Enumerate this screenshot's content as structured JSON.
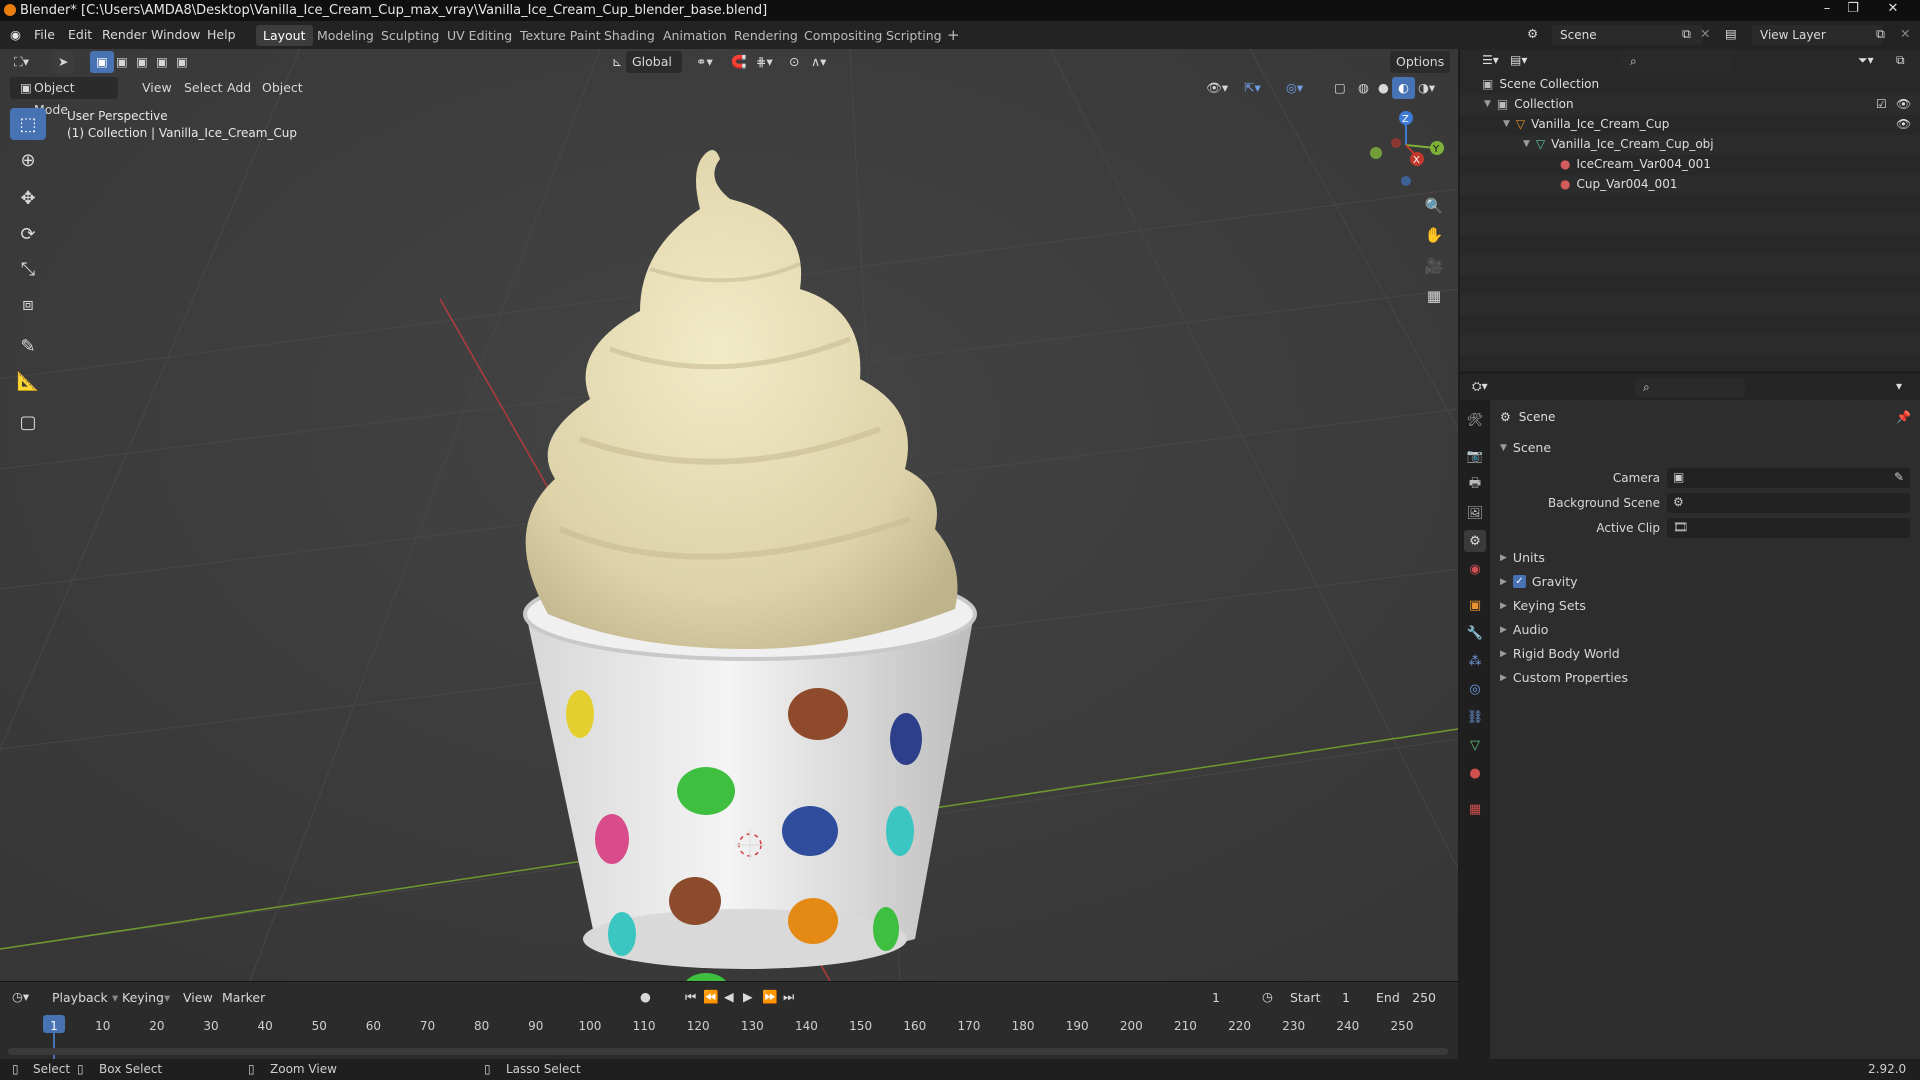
{
  "window": {
    "title": "Blender* [C:\\Users\\AMDA8\\Desktop\\Vanilla_Ice_Cream_Cup_max_vray\\Vanilla_Ice_Cream_Cup_blender_base.blend]"
  },
  "menu": [
    "File",
    "Edit",
    "Render",
    "Window",
    "Help"
  ],
  "workspaces": [
    "Layout",
    "Modeling",
    "Sculpting",
    "UV Editing",
    "Texture Paint",
    "Shading",
    "Animation",
    "Rendering",
    "Compositing",
    "Scripting"
  ],
  "active_workspace": "Layout",
  "scene_field": "Scene",
  "view_layer_field": "View Layer",
  "viewport": {
    "transform_orientation": "Global",
    "options_label": "Options",
    "mode": "Object Mode",
    "header_menu": [
      "View",
      "Select",
      "Add",
      "Object"
    ],
    "overlay_line1": "User Perspective",
    "overlay_line2": "(1) Collection | Vanilla_Ice_Cream_Cup",
    "gizmo": {
      "z": "Z",
      "y": "Y",
      "x": "X"
    }
  },
  "timeline": {
    "menu": [
      "Playback",
      "Keying",
      "View",
      "Marker"
    ],
    "current_frame": "1",
    "start_label": "Start",
    "start_value": "1",
    "end_label": "End",
    "end_value": "250",
    "ticks": [
      "1",
      "10",
      "20",
      "30",
      "40",
      "50",
      "60",
      "70",
      "80",
      "90",
      "100",
      "110",
      "120",
      "130",
      "140",
      "150",
      "160",
      "170",
      "180",
      "190",
      "200",
      "210",
      "220",
      "230",
      "240",
      "250"
    ]
  },
  "statusbar": {
    "select": "Select",
    "box_select": "Box Select",
    "zoom_view": "Zoom View",
    "lasso_select": "Lasso Select",
    "version": "2.92.0"
  },
  "outliner": {
    "root": "Scene Collection",
    "collection": "Collection",
    "object": "Vanilla_Ice_Cream_Cup",
    "mesh": "Vanilla_Ice_Cream_Cup_obj",
    "materials": [
      "IceCream_Var004_001",
      "Cup_Var004_001"
    ]
  },
  "properties": {
    "context": "Scene",
    "panel": "Scene",
    "fields": [
      {
        "label": "Camera"
      },
      {
        "label": "Background Scene"
      },
      {
        "label": "Active Clip"
      }
    ],
    "subpanels": [
      "Units",
      "Gravity",
      "Keying Sets",
      "Audio",
      "Rigid Body World",
      "Custom Properties"
    ],
    "gravity_checked": true
  },
  "colors": {
    "accent_blue": "#4772b3",
    "axis_x": "#c0392b",
    "axis_y": "#7fb03a",
    "axis_z": "#3d7bd6",
    "viewport_bg": "#3b3b3b"
  }
}
